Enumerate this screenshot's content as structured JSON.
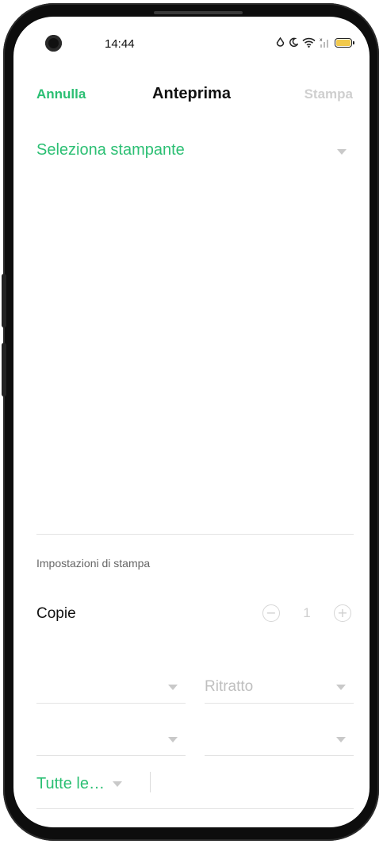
{
  "status_bar": {
    "time": "14:44",
    "icons": [
      "drop-icon",
      "moon-icon",
      "wifi-icon",
      "signal-icon",
      "battery-icon"
    ]
  },
  "header": {
    "cancel_label": "Annulla",
    "title": "Anteprima",
    "print_label": "Stampa"
  },
  "printer": {
    "label": "Seleziona stampante"
  },
  "settings": {
    "title": "Impostazioni di stampa",
    "copies_label": "Copie",
    "copies_value": "1",
    "paper_size": "",
    "orientation": "Ritratto",
    "color_mode": "",
    "duplex": "",
    "pages_label": "Tutte le…"
  },
  "colors": {
    "accent": "#2bbf73",
    "disabled": "#cfcfcf"
  }
}
